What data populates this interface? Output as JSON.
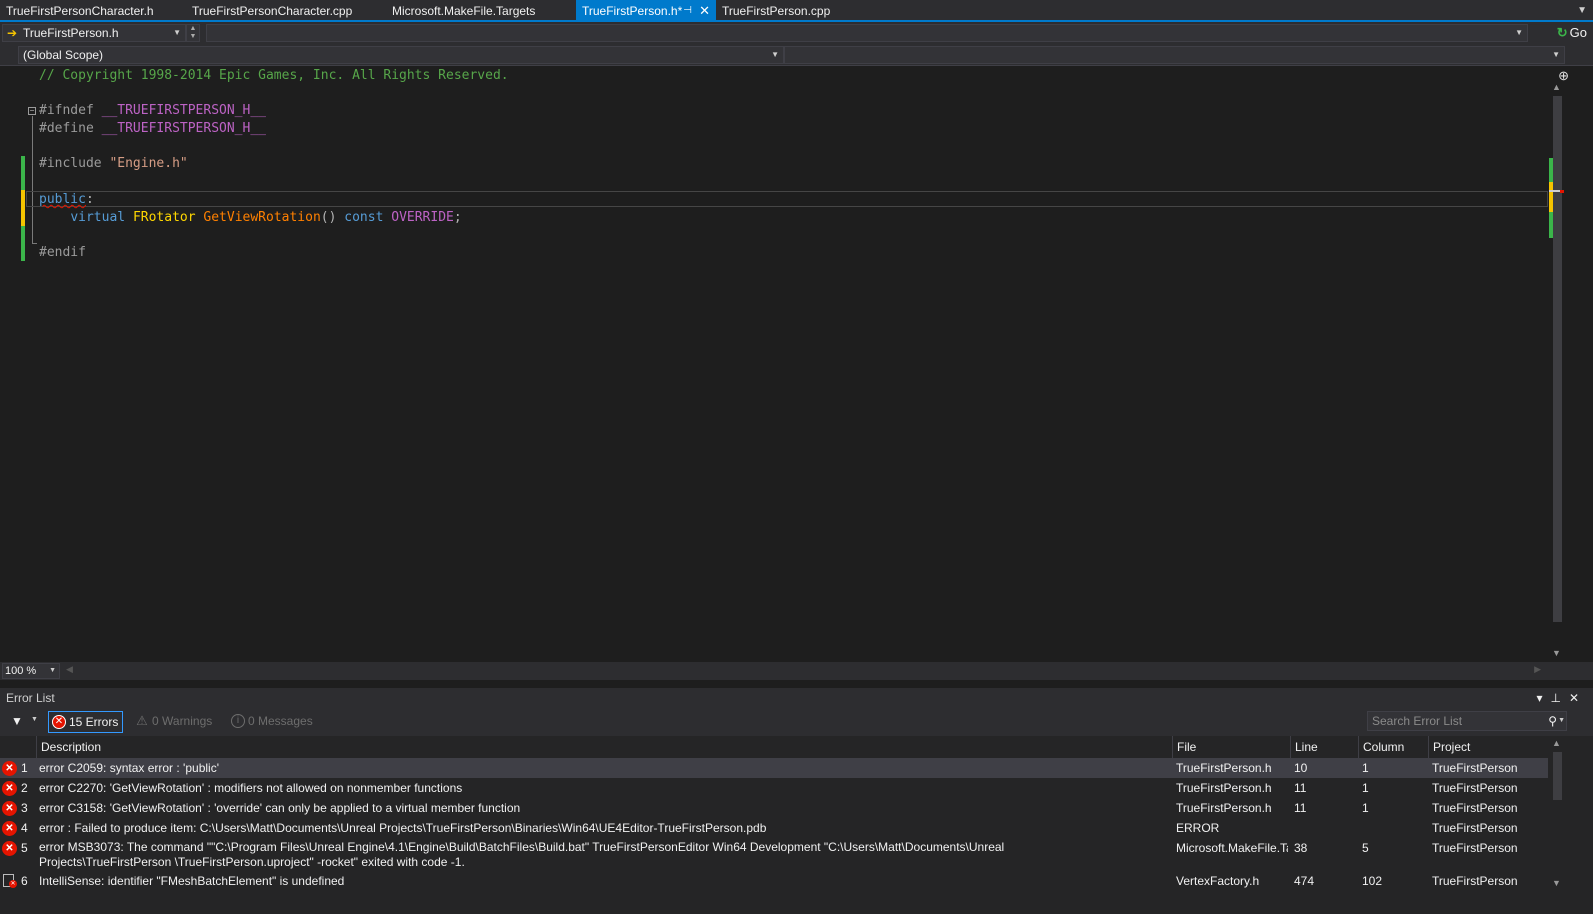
{
  "tabs": [
    {
      "label": "TrueFirstPersonCharacter.h",
      "active": false
    },
    {
      "label": "TrueFirstPersonCharacter.cpp",
      "active": false
    },
    {
      "label": "Microsoft.MakeFile.Targets",
      "active": false
    },
    {
      "label": "TrueFirstPerson.h*",
      "active": true
    },
    {
      "label": "TrueFirstPerson.cpp",
      "active": false
    }
  ],
  "nav": {
    "file_selector": "TrueFirstPerson.h",
    "scope_selector": "(Global Scope)",
    "go_label": "Go"
  },
  "editor": {
    "lines": [
      {
        "tokens": [
          {
            "t": "// Copyright 1998-2014 Epic Games, Inc. All Rights Reserved.",
            "c": "comment"
          }
        ]
      },
      {
        "tokens": []
      },
      {
        "tokens": [
          {
            "t": "#ifndef ",
            "c": "prep"
          },
          {
            "t": "__TRUEFIRSTPERSON_H__",
            "c": "macro"
          }
        ]
      },
      {
        "tokens": [
          {
            "t": "#define ",
            "c": "prep"
          },
          {
            "t": "__TRUEFIRSTPERSON_H__",
            "c": "macro"
          }
        ]
      },
      {
        "tokens": []
      },
      {
        "tokens": [
          {
            "t": "#include ",
            "c": "prep"
          },
          {
            "t": "\"Engine.h\"",
            "c": "string"
          }
        ]
      },
      {
        "tokens": []
      },
      {
        "tokens": [
          {
            "t": "public",
            "c": "kw",
            "squiggle": true
          },
          {
            "t": ":",
            "c": "punc"
          }
        ]
      },
      {
        "tokens": [
          {
            "t": "    ",
            "c": "punc"
          },
          {
            "t": "virtual ",
            "c": "kw"
          },
          {
            "t": "FRotator ",
            "c": "type"
          },
          {
            "t": "GetViewRotation",
            "c": "func"
          },
          {
            "t": "() ",
            "c": "punc"
          },
          {
            "t": "const ",
            "c": "kw"
          },
          {
            "t": "OVERRIDE",
            "c": "macro"
          },
          {
            "t": ";",
            "c": "punc"
          }
        ]
      },
      {
        "tokens": []
      },
      {
        "tokens": [
          {
            "t": "#endif",
            "c": "prep"
          }
        ]
      }
    ],
    "zoom": "100 %"
  },
  "error_list": {
    "title": "Error List",
    "errors_label": "15 Errors",
    "warnings_label": "0 Warnings",
    "messages_label": "0 Messages",
    "search_placeholder": "Search Error List",
    "columns": {
      "description": "Description",
      "file": "File",
      "line": "Line",
      "column": "Column",
      "project": "Project"
    },
    "rows": [
      {
        "num": "1",
        "kind": "error",
        "description": "error C2059: syntax error : 'public'",
        "file": "TrueFirstPerson.h",
        "line": "10",
        "column": "1",
        "project": "TrueFirstPerson",
        "selected": true
      },
      {
        "num": "2",
        "kind": "error",
        "description": "error C2270: 'GetViewRotation' : modifiers not allowed on nonmember functions",
        "file": "TrueFirstPerson.h",
        "line": "11",
        "column": "1",
        "project": "TrueFirstPerson"
      },
      {
        "num": "3",
        "kind": "error",
        "description": "error C3158: 'GetViewRotation' : 'override' can only be applied to a virtual member function",
        "file": "TrueFirstPerson.h",
        "line": "11",
        "column": "1",
        "project": "TrueFirstPerson"
      },
      {
        "num": "4",
        "kind": "error",
        "description": "error : Failed to produce item: C:\\Users\\Matt\\Documents\\Unreal Projects\\TrueFirstPerson\\Binaries\\Win64\\UE4Editor-TrueFirstPerson.pdb",
        "file": "ERROR",
        "line": "",
        "column": "",
        "project": "TrueFirstPerson"
      },
      {
        "num": "5",
        "kind": "error",
        "description": "error MSB3073: The command \"\"C:\\Program Files\\Unreal Engine\\4.1\\Engine\\Build\\BatchFiles\\Build.bat\" TrueFirstPersonEditor Win64 Development \"C:\\Users\\Matt\\Documents\\Unreal Projects\\TrueFirstPerson \\TrueFirstPerson.uproject\" -rocket\" exited with code -1.",
        "file": "Microsoft.MakeFile.Ta",
        "line": "38",
        "column": "5",
        "project": "TrueFirstPerson"
      },
      {
        "num": "6",
        "kind": "intellisense",
        "description": "IntelliSense: identifier \"FMeshBatchElement\" is undefined",
        "file": "VertexFactory.h",
        "line": "474",
        "column": "102",
        "project": "TrueFirstPerson"
      }
    ]
  },
  "colors": {
    "accent": "#007acc",
    "error": "#e51400",
    "change_saved": "#3bb54a",
    "change_unsaved": "#f5c400"
  },
  "icons": [
    "arrow-right-icon",
    "pin-icon",
    "close-icon",
    "go-icon",
    "split-icon",
    "filter-icon",
    "error-icon",
    "warning-icon",
    "info-icon",
    "search-icon",
    "intellisense-error-icon"
  ]
}
